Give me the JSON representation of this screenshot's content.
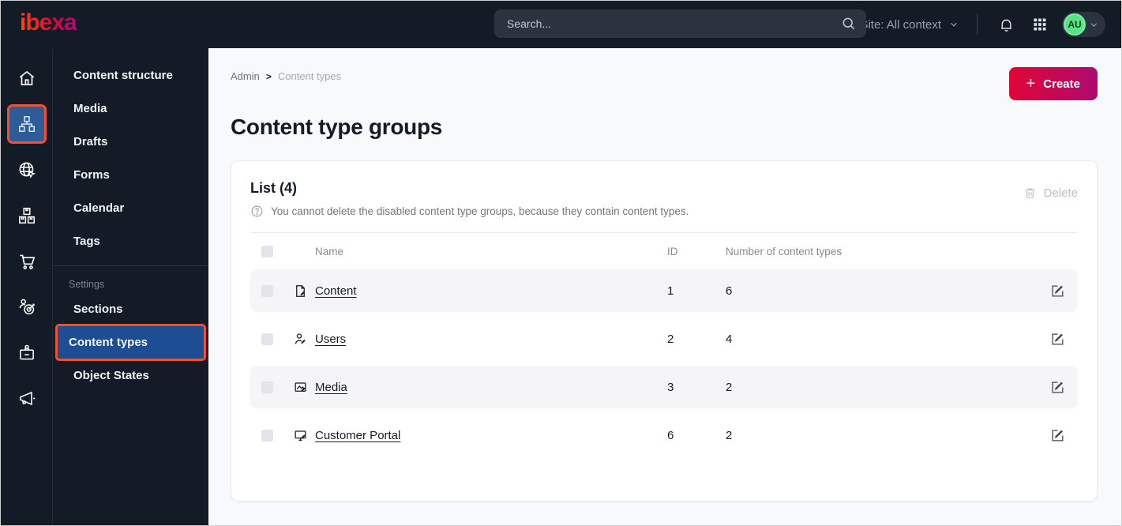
{
  "topbar": {
    "logo": "ibexa",
    "search_placeholder": "Search...",
    "site_context_label": "Site: All context",
    "avatar_initials": "AU"
  },
  "sidebar": {
    "icons": [
      {
        "name": "home"
      },
      {
        "name": "content-structure",
        "active": true
      },
      {
        "name": "site"
      },
      {
        "name": "product-catalog"
      },
      {
        "name": "commerce"
      },
      {
        "name": "personalization"
      },
      {
        "name": "admin"
      },
      {
        "name": "marketing"
      }
    ]
  },
  "menu": {
    "items": [
      {
        "label": "Content structure"
      },
      {
        "label": "Media"
      },
      {
        "label": "Drafts"
      },
      {
        "label": "Forms"
      },
      {
        "label": "Calendar"
      },
      {
        "label": "Tags"
      }
    ],
    "settings_label": "Settings",
    "settings_items": [
      {
        "label": "Sections"
      },
      {
        "label": "Content types",
        "active": true
      },
      {
        "label": "Object States"
      }
    ]
  },
  "main": {
    "breadcrumb": {
      "root": "Admin",
      "current": "Content types"
    },
    "create_label": "Create",
    "page_title": "Content type groups",
    "card": {
      "list_title": "List (4)",
      "info_text": "You cannot delete the disabled content type groups, because they contain content types.",
      "delete_label": "Delete",
      "columns": {
        "name": "Name",
        "id": "ID",
        "count": "Number of content types"
      },
      "rows": [
        {
          "icon": "file-icon",
          "name": "Content",
          "id": "1",
          "count": "6"
        },
        {
          "icon": "user-icon",
          "name": "Users",
          "id": "2",
          "count": "4"
        },
        {
          "icon": "image-icon",
          "name": "Media",
          "id": "3",
          "count": "2"
        },
        {
          "icon": "monitor-icon",
          "name": "Customer Portal",
          "id": "6",
          "count": "2"
        }
      ]
    }
  },
  "colors": {
    "dark": "#131c26",
    "active_blue": "#1d4d92",
    "highlight_orange": "#f4502e",
    "create_gradient_start": "#e00637",
    "create_gradient_end": "#ad0a70",
    "avatar_green": "#55e583",
    "row_alt": "#f5f5f8"
  }
}
